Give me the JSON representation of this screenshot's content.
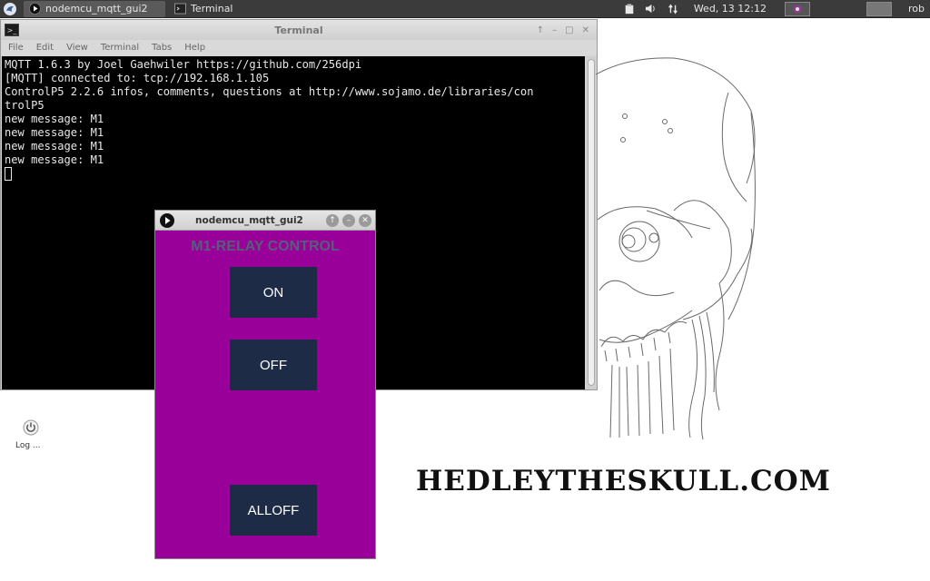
{
  "panel": {
    "tasks": [
      {
        "label": "nodemcu_mqtt_gui2",
        "icon": "processing-icon",
        "active": true
      },
      {
        "label": "Terminal",
        "icon": "terminal-icon",
        "active": false
      }
    ],
    "clock": "Wed, 13 12:12",
    "user": "rob"
  },
  "terminal": {
    "title": "Terminal",
    "menu": [
      "File",
      "Edit",
      "View",
      "Terminal",
      "Tabs",
      "Help"
    ],
    "lines": [
      "MQTT 1.6.3 by Joel Gaehwiler https://github.com/256dpi",
      "[MQTT] connected to: tcp://192.168.1.105",
      "ControlP5 2.2.6 infos, comments, questions at http://www.sojamo.de/libraries/con",
      "trolP5",
      "new message: M1",
      "new message: M1",
      "new message: M1",
      "new message: M1"
    ]
  },
  "desktop": {
    "logout_label": "Log ..."
  },
  "sketch": {
    "title": "nodemcu_mqtt_gui2",
    "heading": "M1-RELAY CONTROL",
    "buttons": {
      "on": "ON",
      "off": "OFF",
      "alloff": "ALLOFF"
    },
    "background": "#990099",
    "button_color": "#1e2b46"
  },
  "wallpaper": {
    "brand": "HEDLEYTHESKULL.COM"
  }
}
